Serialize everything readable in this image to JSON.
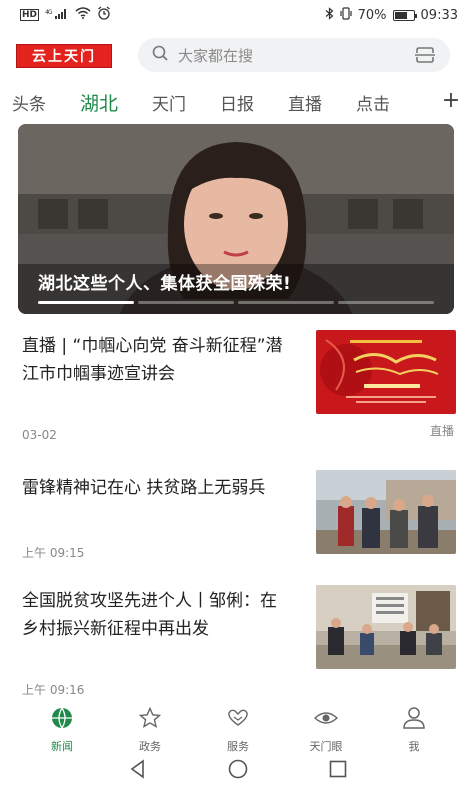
{
  "status_bar": {
    "hd": "HD",
    "network": "4G",
    "battery_percent": "70%",
    "battery_level": 0.7,
    "time": "09:33"
  },
  "header": {
    "logo_text": "云上天门",
    "search_placeholder": "大家都在搜",
    "brand_color": "#e4231e"
  },
  "tabs": [
    {
      "label": "头条",
      "active": false
    },
    {
      "label": "湖北",
      "active": true
    },
    {
      "label": "天门",
      "active": false
    },
    {
      "label": "日报",
      "active": false
    },
    {
      "label": "直播",
      "active": false
    },
    {
      "label": "点击",
      "active": false
    }
  ],
  "accent_color": "#1f8a4a",
  "banner": {
    "title": "湖北这些个人、集体获全国殊荣!",
    "slide_index": 1,
    "slide_count": 4
  },
  "news": [
    {
      "title": "直播 | “巾帼心向党 奋斗新征程”潜江市巾帼事迹宣讲会",
      "time": "03-02",
      "tag": "直播",
      "thumb_icon": "event-poster-image"
    },
    {
      "title": "雷锋精神记在心  扶贫路上无弱兵",
      "time": "上午 09:15",
      "tag": "",
      "thumb_icon": "village-people-image"
    },
    {
      "title": "全国脱贫攻坚先进个人丨邹俐：在乡村振兴新征程中再出发",
      "time": "上午 09:16",
      "tag": "",
      "thumb_icon": "courtyard-meeting-image"
    }
  ],
  "bottom_nav": [
    {
      "label": "新闻",
      "icon": "globe-icon",
      "active": true
    },
    {
      "label": "政务",
      "icon": "star-icon",
      "active": false
    },
    {
      "label": "服务",
      "icon": "heart-hands-icon",
      "active": false
    },
    {
      "label": "天门眼",
      "icon": "eye-icon",
      "active": false
    },
    {
      "label": "我",
      "icon": "user-icon",
      "active": false
    }
  ]
}
